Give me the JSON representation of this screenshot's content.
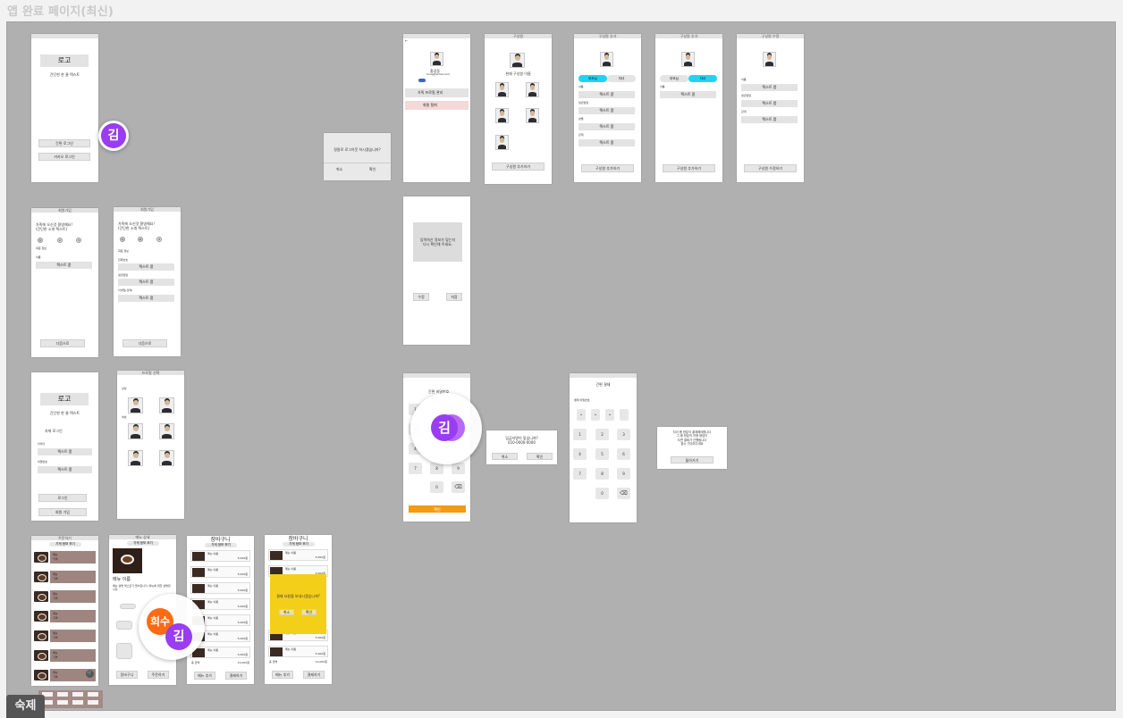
{
  "page_title": "앱 완료 페이지(최신)",
  "bottom_label": "숙제",
  "login": {
    "logo": "로고",
    "subtitle": "간단한 한 줄 텍스트",
    "btn_simple": "간편 로그인",
    "btn_kakao": "카카오 로그인"
  },
  "signup1": {
    "title": "회원가입",
    "heading": "가족에 오신것 환영해요!\n(간단한 소개 텍스트)",
    "steps": [
      "1",
      "2",
      "3"
    ],
    "section": "회원 정보",
    "field_label": "이름",
    "field_value": "텍스트 폼",
    "next": "다음으로"
  },
  "signup2": {
    "title": "회원가입",
    "heading": "가족에 오신것 환영해요!\n(간단한 소개 텍스트)",
    "steps": [
      "1",
      "2",
      "3"
    ],
    "section": "회원 정보",
    "labels": [
      "전화번호",
      "생년월일",
      "닉네임(선택)"
    ],
    "field_value": "텍스트 폼",
    "next": "다음으로"
  },
  "login2": {
    "logo": "로고",
    "subtitle": "간단한 한 줄 텍스트",
    "section": "자체 로그인",
    "labels": [
      "아이디",
      "비밀번호"
    ],
    "field_value": "텍스트 폼",
    "btn_login": "로그인",
    "btn_signup": "회원 가입"
  },
  "profile_select": {
    "title": "프로필 선택",
    "labels": [
      "남성",
      "여성"
    ]
  },
  "popup": {
    "message": "정말로 로그아웃 하시겠습니까?",
    "cancel": "취소",
    "confirm": "확인"
  },
  "mypage": {
    "name": "홍길동",
    "email": "hong@email.com",
    "tag": "관리자",
    "menu1": "가족 프로필 관리",
    "menu2": "회원 탈퇴"
  },
  "members": {
    "title": "구성원",
    "subtitle": "현재 구성원 이름",
    "labels": [
      "가족",
      "친구"
    ],
    "btn": "구성원 추가하기"
  },
  "member_add1": {
    "title": "구성원 추가",
    "tabs": [
      "부모님",
      "자녀"
    ],
    "labels": [
      "이름",
      "생년월일",
      "성별",
      "관계"
    ],
    "field_value": "텍스트 폼",
    "btn": "구성원 추가하기"
  },
  "member_add2": {
    "title": "구성원 추가",
    "tabs": [
      "부모님",
      "자녀"
    ],
    "label": "이름",
    "field_value": "텍스트 폼",
    "btn": "구성원 추가하기"
  },
  "member_edit": {
    "title": "구성원 수정",
    "labels": [
      "이름",
      "생년월일",
      "관계"
    ],
    "field_value": "텍스트 폼",
    "btn": "구성원 수정하기"
  },
  "confirm_box": {
    "message": "입력하신 정보가 맞는지\n다시 확인해 주세요.",
    "edit": "수정",
    "ok": "저장"
  },
  "keypad1": {
    "title": "간편 비밀번호",
    "keys": [
      "1",
      "2",
      "3",
      "4",
      "5",
      "6",
      "7",
      "8",
      "9",
      "0"
    ],
    "submit": "확인"
  },
  "call_popup": {
    "message": "입금자명이 맞습니까?\n010-0000-0000",
    "cancel": "취소",
    "ok": "확인"
  },
  "keypad2": {
    "title": "간편 결제",
    "label": "결제 비밀번호",
    "keys": [
      "1",
      "2",
      "3",
      "4",
      "5",
      "6",
      "7",
      "8",
      "9",
      "0"
    ]
  },
  "done_popup": {
    "message": "자녀 중 한분이 결제해야합니다\n그 중 한분의 허용 응답이\n오면 결제가 진행됩니다\n잠시 기다려주세요",
    "btn": "돌아가기"
  },
  "menu_list": {
    "title": "주문하기",
    "chip": "가게 정보 보기"
  },
  "menu_detail": {
    "title": "메뉴 상세",
    "chip": "가게 정보 보기",
    "name": "메뉴 이름",
    "desc": "메뉴 설명 텍스트가 들어갑니다. 메뉴에 대한 설명입니다.",
    "cart": "장바구니",
    "order": "주문하기"
  },
  "cart1": {
    "title": "장바구니",
    "chip": "가게 정보 보기",
    "item": "메뉴 이름",
    "price": "5,000원",
    "total_label": "총 금액",
    "total": "10,000원",
    "add": "메뉴 추가",
    "pay": "결제하기"
  },
  "cart2": {
    "title": "장바구니",
    "chip": "가게 정보 보기",
    "item": "메뉴 이름",
    "price": "5,000원",
    "total_label": "총 금액",
    "total": "10,000원",
    "popup": "결제 요청을 보내시겠습니까?",
    "cancel": "취소",
    "ok": "확인",
    "add": "메뉴 추가",
    "pay": "결제하기"
  },
  "avatars": {
    "kim": "김",
    "heesu": "희수"
  },
  "colors": {
    "canvas": "#b0b0b0",
    "purple": "#9a3cf0",
    "orange": "#ff6a13",
    "cyan": "#21d3f3",
    "yellow": "#f4cf1a",
    "brown_row": "#9e8580",
    "order_btn": "#f39b12"
  }
}
